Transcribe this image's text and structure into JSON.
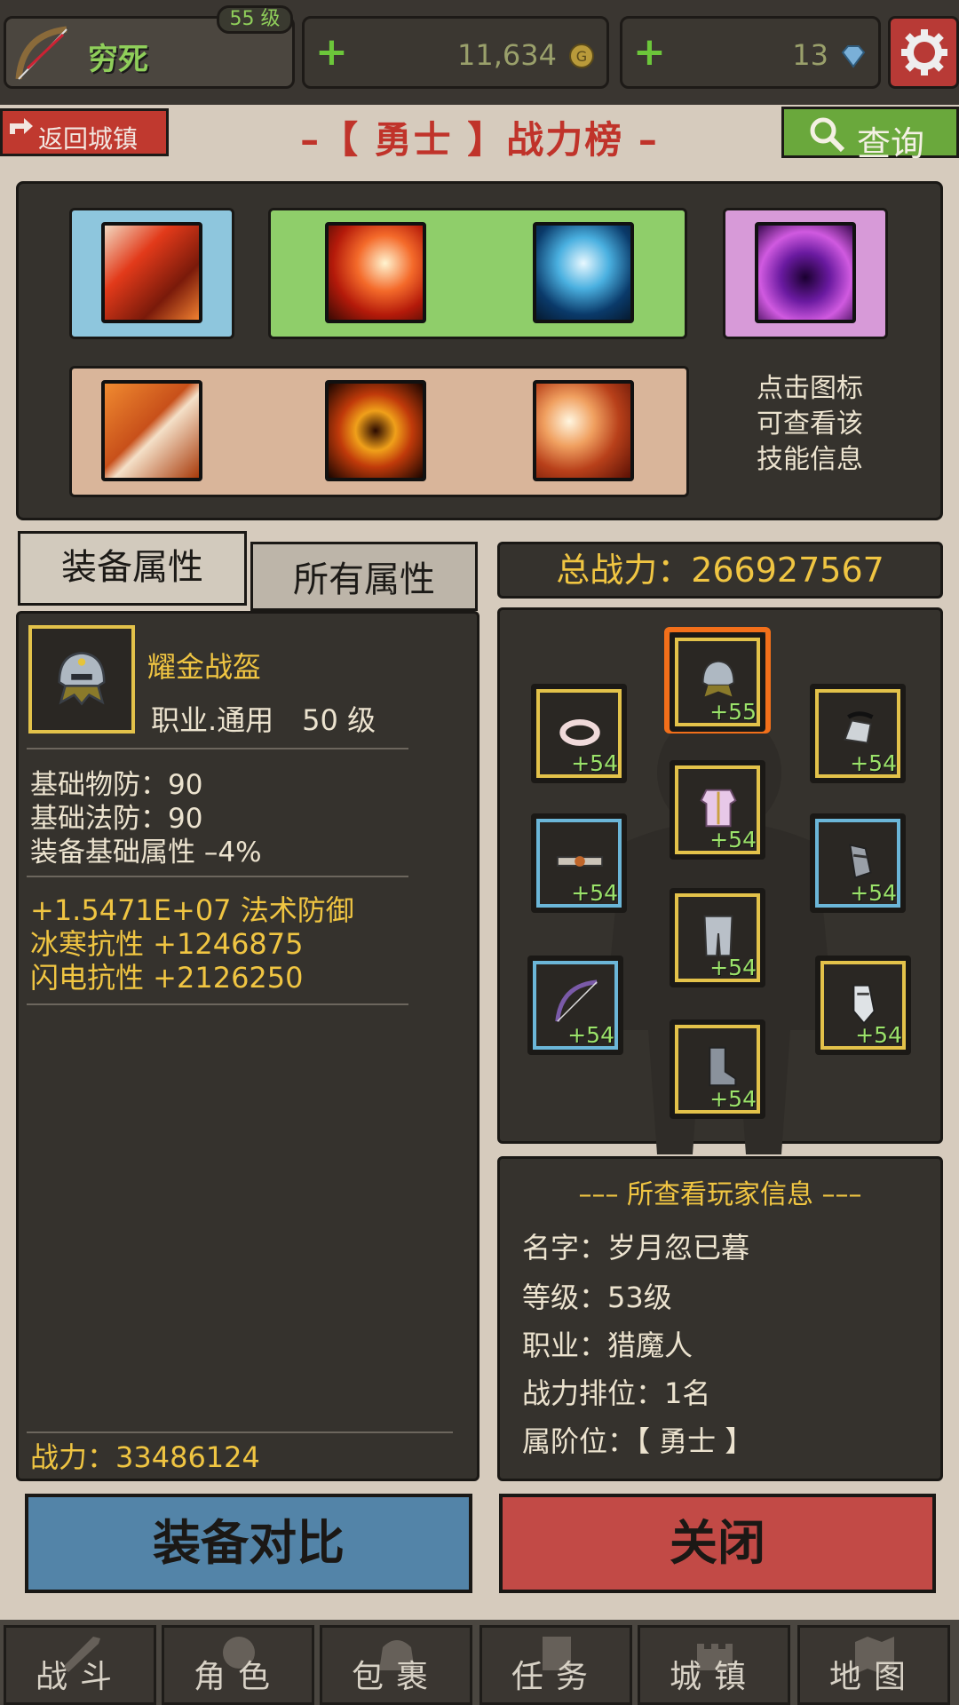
{
  "header": {
    "player_name": "穷死",
    "level": "55 级",
    "gold": "11,634",
    "gems": "13"
  },
  "title_row": {
    "back_label": "返回城镇",
    "title": "–【 勇士 】战力榜 –",
    "query_label": "查询"
  },
  "skills": {
    "hint_lines": [
      "点击图标",
      "可查看该",
      "技能信息"
    ]
  },
  "tabs": {
    "equip_attr": "装备属性",
    "all_attr": "所有属性"
  },
  "equipment": {
    "name": "耀金战盔",
    "meta": "职业.通用　50 级",
    "base_stats": [
      "基础物防：90",
      "基础法防：90",
      "装备基础属性 –4%"
    ],
    "bonus_stats": [
      "+1.5471E+07 法术防御",
      "冰寒抗性 +1246875",
      "闪电抗性 +2126250"
    ],
    "power": "战力：33486124"
  },
  "total_power": "总战力：266927567",
  "slots": [
    {
      "name": "helmet",
      "level": "+55"
    },
    {
      "name": "ring",
      "level": "+54"
    },
    {
      "name": "gloves-right",
      "level": "+54"
    },
    {
      "name": "chest",
      "level": "+54"
    },
    {
      "name": "belt",
      "level": "+54"
    },
    {
      "name": "bracer",
      "level": "+54"
    },
    {
      "name": "legs",
      "level": "+54"
    },
    {
      "name": "bow",
      "level": "+54"
    },
    {
      "name": "boots",
      "level": "+54"
    },
    {
      "name": "glove-left",
      "level": "+54"
    }
  ],
  "player_info": {
    "title": "––– 所查看玩家信息 –––",
    "name": "名字：岁月忽已暮",
    "level": "等级：53级",
    "class": "职业：猎魔人",
    "rank": "战力排位：1名",
    "tier": "属阶位：【 勇士 】"
  },
  "buttons": {
    "compare": "装备对比",
    "close": "关闭"
  },
  "nav": [
    "战斗",
    "角色",
    "包裹",
    "任务",
    "城镇",
    "地图"
  ],
  "colors": {
    "gold_text": "#f0c542",
    "green_text": "#8fce5a",
    "compare_btn": "#5384a8",
    "close_btn": "#c24a46"
  }
}
